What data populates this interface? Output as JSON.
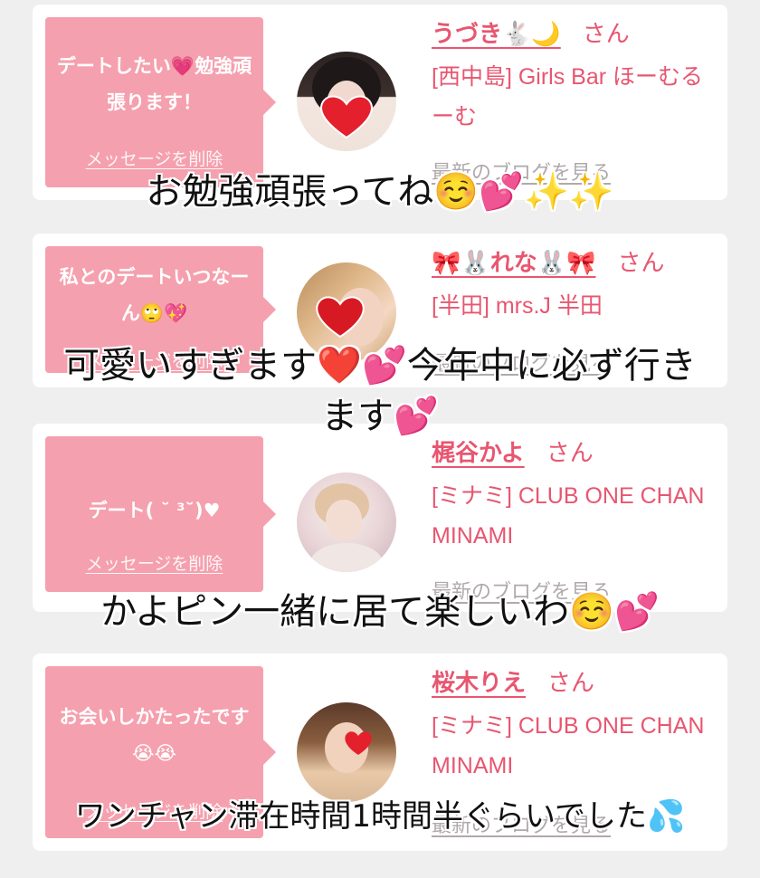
{
  "cards": [
    {
      "message": "デートしたい💗勉強頑張ります！",
      "delete_label": "メッセージを削除",
      "name": "うづき🐇🌙",
      "honorific": "さん",
      "shop": "[西中島] Girls Bar ほーむるーむ",
      "blog_link": "最新のブログを見る",
      "avatar_colors": [
        "#2b2222",
        "#f2e7e0"
      ],
      "sticker": "❤️"
    },
    {
      "message": "私とのデートいつなーん🙄💖",
      "delete_label": "メッセージを削除",
      "name": "🎀🐰れな🐰🎀",
      "honorific": "さん",
      "shop": "[半田] mrs.J 半田",
      "blog_link": "最新のブログを見る",
      "avatar_colors": [
        "#c9a06a",
        "#f4d8c2"
      ],
      "sticker": "❤️"
    },
    {
      "message": "デート( ˘ ³˘)♥",
      "delete_label": "メッセージを削除",
      "name": "梶谷かよ",
      "honorific": "さん",
      "shop": "[ミナミ] CLUB ONE CHAN MINAMI",
      "blog_link": "最新のブログを見る",
      "avatar_colors": [
        "#e7d0d6",
        "#f6efe9"
      ],
      "sticker": ""
    },
    {
      "message": "お会いしかたったです😭😭",
      "delete_label": "メッセージを削除",
      "name": "桜木りえ",
      "honorific": "さん",
      "shop": "[ミナミ] CLUB ONE CHAN MINAMI",
      "blog_link": "最新のブログを見る",
      "avatar_colors": [
        "#7a5238",
        "#e8c9a8"
      ],
      "sticker": "❤️"
    }
  ],
  "captions": [
    "お勉強頑張ってね☺️💕✨✨",
    "可愛いすぎます❤️💕今年中に必ず行き",
    "ます💕",
    "かよピン一緒に居て楽しいわ☺️💕",
    "ワンチャン滞在時間1時間半ぐらいでした💦"
  ],
  "colors": {
    "accent": "#e85670",
    "bubble": "#f5a0ae",
    "background": "#f0efef",
    "muted": "#b0a9ab"
  }
}
